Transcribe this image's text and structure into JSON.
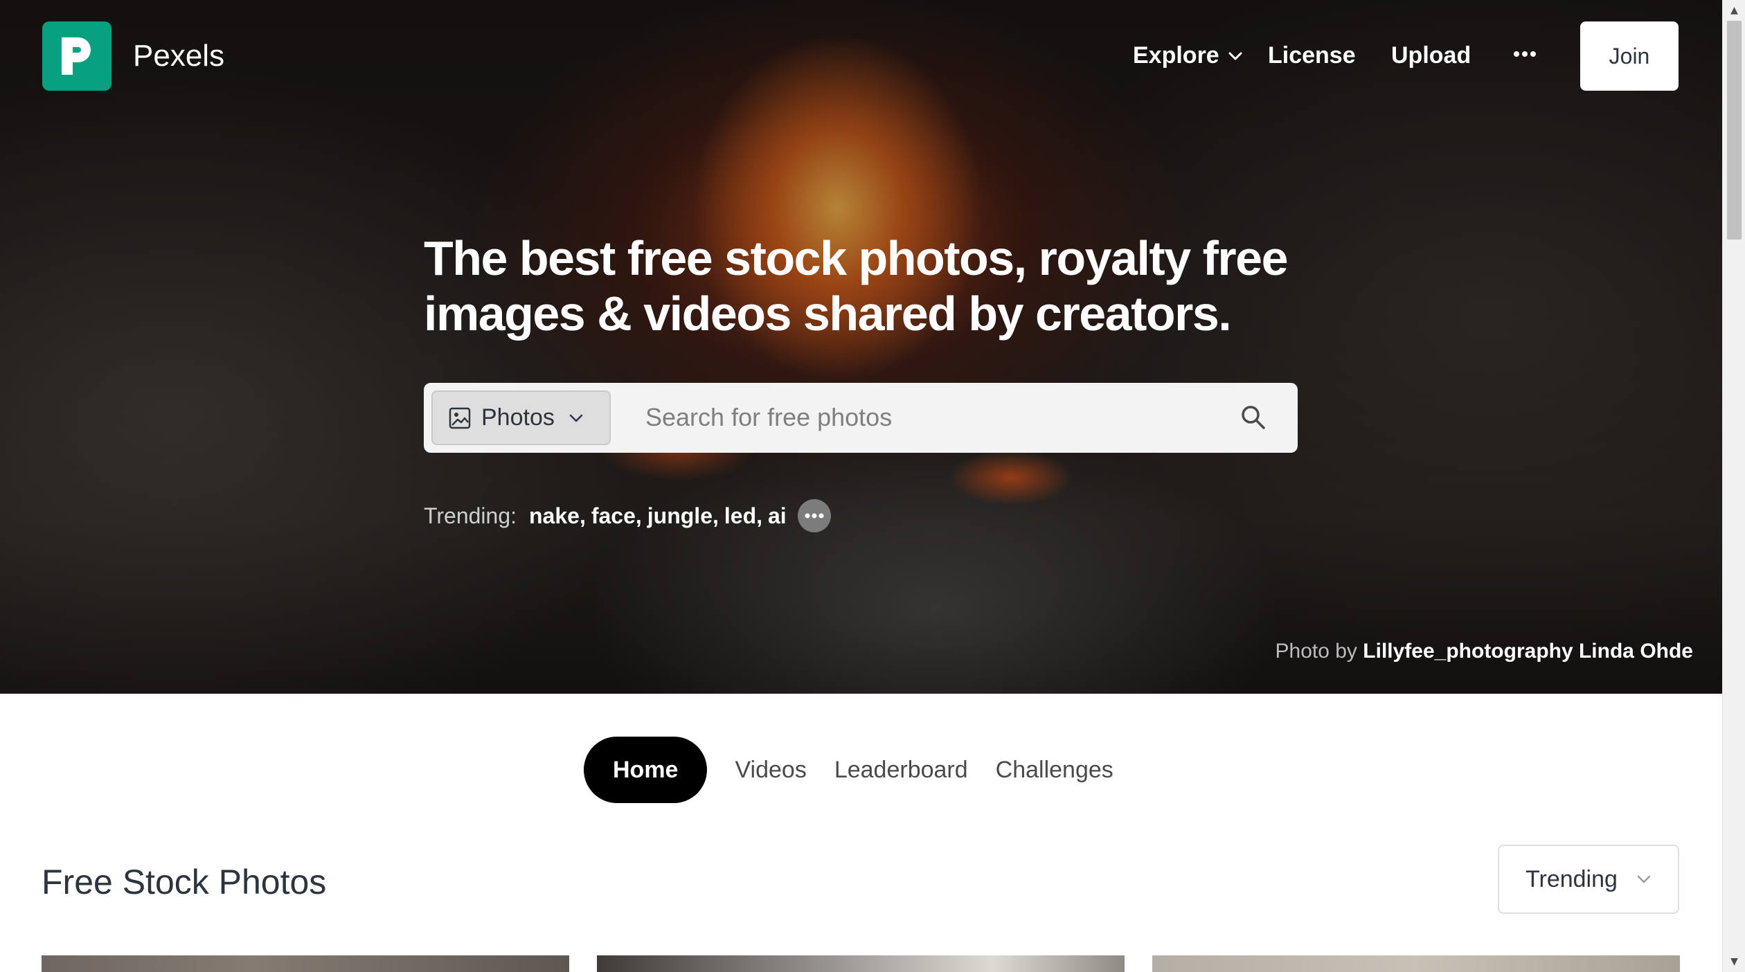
{
  "brand": {
    "name": "Pexels",
    "logo_letter": "P",
    "accent_color": "#07a081"
  },
  "nav": {
    "explore_label": "Explore",
    "license_label": "License",
    "upload_label": "Upload",
    "more_icon": "ellipsis-icon",
    "join_label": "Join"
  },
  "hero": {
    "headline_line1": "The best free stock photos, royalty free",
    "headline_line2": "images & videos shared by creators.",
    "search": {
      "type_label": "Photos",
      "placeholder": "Search for free photos",
      "value": ""
    },
    "trending": {
      "label": "Trending:",
      "items": [
        "nake",
        "face",
        "jungle",
        "led",
        "ai"
      ]
    },
    "credit": {
      "prefix": "Photo by",
      "name": "Lillyfee_photography Linda Ohde"
    }
  },
  "tabs": [
    {
      "label": "Home",
      "active": true
    },
    {
      "label": "Videos",
      "active": false
    },
    {
      "label": "Leaderboard",
      "active": false
    },
    {
      "label": "Challenges",
      "active": false
    }
  ],
  "section": {
    "title": "Free Stock Photos",
    "sort_label": "Trending"
  }
}
